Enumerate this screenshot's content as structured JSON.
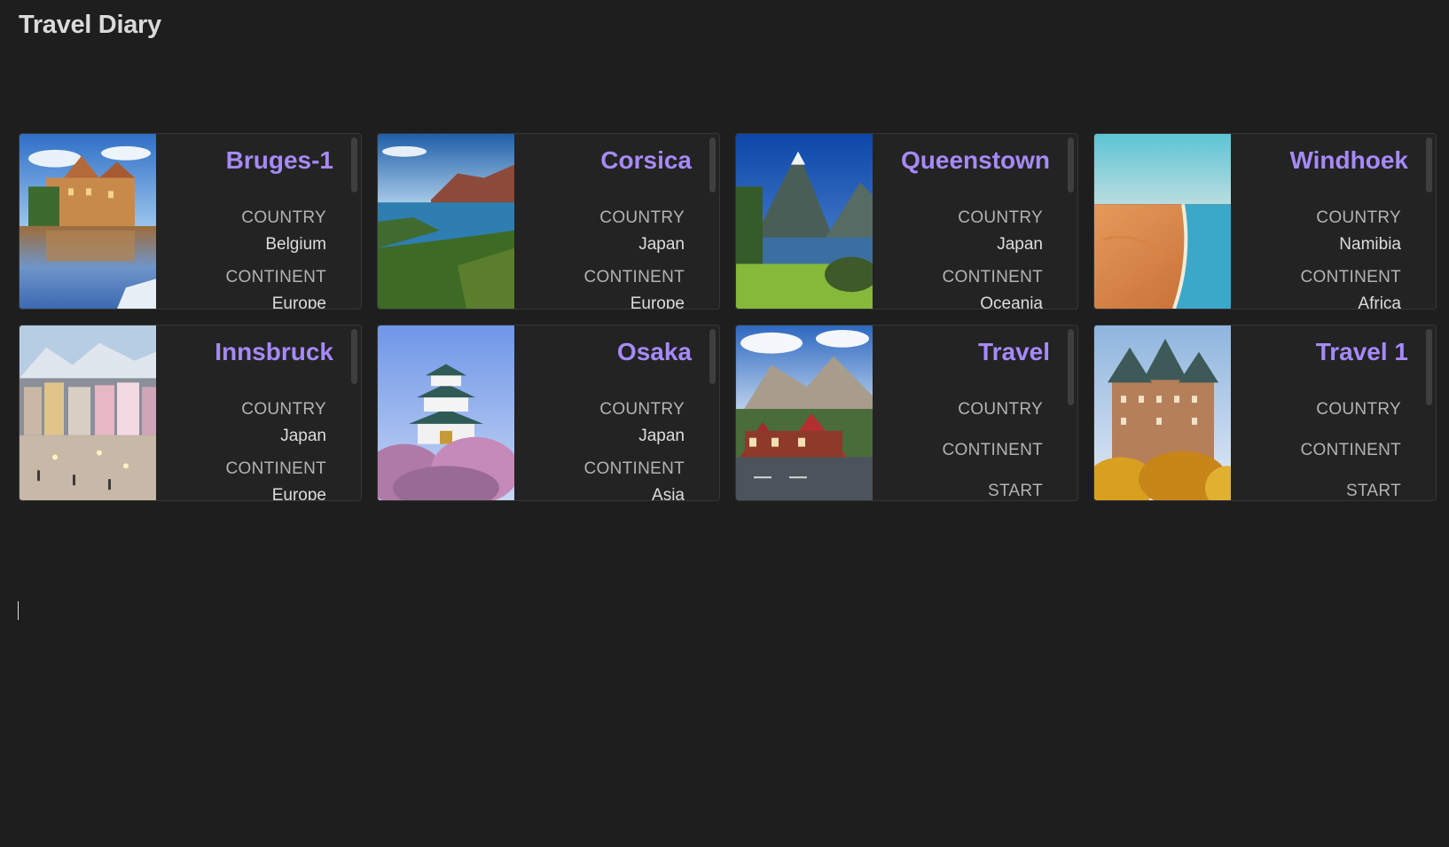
{
  "page": {
    "title": "Travel Diary"
  },
  "colors": {
    "background": "#1e1e1e",
    "card_background": "#232323",
    "accent_title": "#a68af9",
    "label": "#b3b3b3",
    "value": "#dcddde"
  },
  "cards": [
    {
      "title": "Bruges-1",
      "image": "bruges-canal-houses",
      "props": [
        {
          "label": "COUNTRY",
          "value": "Belgium"
        },
        {
          "label": "CONTINENT",
          "value": "Europe"
        }
      ]
    },
    {
      "title": "Corsica",
      "image": "corsica-coast",
      "props": [
        {
          "label": "COUNTRY",
          "value": "Japan"
        },
        {
          "label": "CONTINENT",
          "value": "Europe"
        }
      ]
    },
    {
      "title": "Queenstown",
      "image": "mitre-peak-fjord",
      "props": [
        {
          "label": "COUNTRY",
          "value": "Japan"
        },
        {
          "label": "CONTINENT",
          "value": "Oceania"
        }
      ]
    },
    {
      "title": "Windhoek",
      "image": "namib-desert-coast",
      "props": [
        {
          "label": "COUNTRY",
          "value": "Namibia"
        },
        {
          "label": "CONTINENT",
          "value": "Africa"
        }
      ]
    },
    {
      "title": "Innsbruck",
      "image": "innsbruck-street-mountains",
      "props": [
        {
          "label": "COUNTRY",
          "value": "Japan"
        },
        {
          "label": "CONTINENT",
          "value": "Europe"
        }
      ]
    },
    {
      "title": "Osaka",
      "image": "osaka-castle-blossoms",
      "props": [
        {
          "label": "COUNTRY",
          "value": "Japan"
        },
        {
          "label": "CONTINENT",
          "value": "Asia"
        }
      ]
    },
    {
      "title": "Travel",
      "image": "mountain-lodge",
      "props": [
        {
          "label": "COUNTRY",
          "value": ""
        },
        {
          "label": "CONTINENT",
          "value": ""
        },
        {
          "label": "START",
          "value": ""
        }
      ]
    },
    {
      "title": "Travel 1",
      "image": "chateau-autumn",
      "props": [
        {
          "label": "COUNTRY",
          "value": ""
        },
        {
          "label": "CONTINENT",
          "value": ""
        },
        {
          "label": "START",
          "value": ""
        }
      ]
    }
  ]
}
